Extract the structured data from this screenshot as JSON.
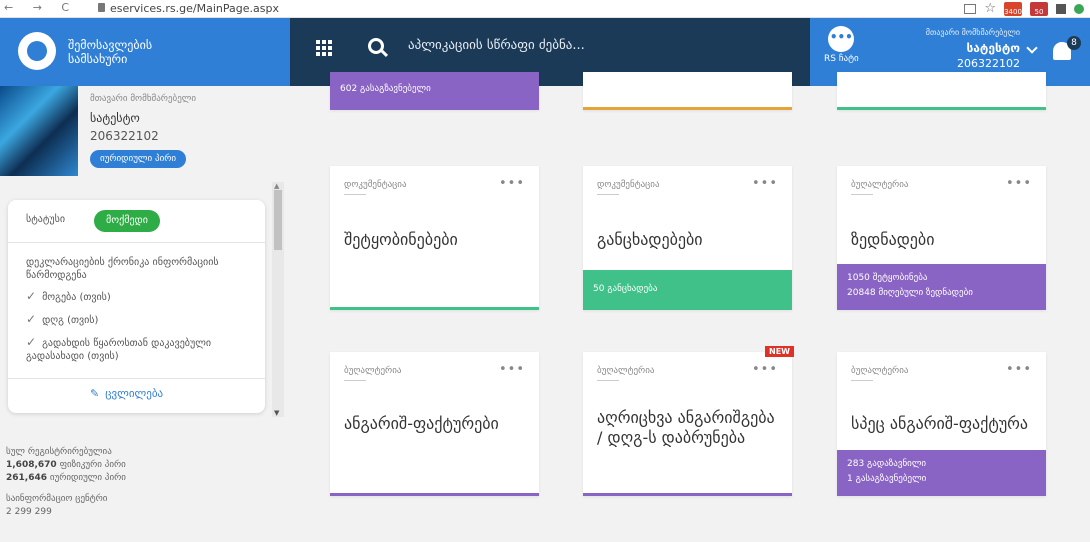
{
  "browser": {
    "url": "eservices.rs.ge/MainPage.aspx",
    "nav_glyphs": "← → C",
    "star": "☆",
    "ext1_count": "3400",
    "ext2_count": "50"
  },
  "header": {
    "brand_line1": "შემოსავლების",
    "brand_line2": "სამსახური",
    "search_placeholder": "აპლიკაციის სწრაფი ძებნა...",
    "chat_label": "RS ჩატი",
    "chat_icon_glyph": "•••",
    "user_role": "მთავარი მომხმარებელი",
    "user_name": "სატესტო",
    "user_id": "206322102",
    "notification_count": "8"
  },
  "sidebar": {
    "profile_role": "მთავარი მომხმარებელი",
    "profile_name": "სატესტო",
    "profile_id": "206322102",
    "profile_type": "იურიდიული პირი",
    "status_label": "სტატუსი",
    "status_value": "მოქმედი",
    "declarations_title": "დეკლარაციების ქრონიკა ინფორმაციის წარმოდგენა",
    "checks": [
      "მოგება (თვის)",
      "დღგ (თვის)",
      "გადახდის წყაროსთან დაკავებული გადასახადი (თვის)"
    ],
    "edit_label": "ცვლილება",
    "stats_label1": "სულ რეგისტრირებულია",
    "stats_val1": "1,608,670",
    "stats_unit1": "ფიზიკური პირი",
    "stats_val2": "261,646",
    "stats_unit2": "იურიდიული პირი",
    "stats_label2": "საინფორმაციო ცენტრი",
    "stats_val3": "2 299 299"
  },
  "tiles_top": {
    "tile1_band": "602 გასაგზავნებელი"
  },
  "tiles": [
    {
      "category": "დოკუმენტაცია",
      "title": "შეტყობინებები",
      "band": ""
    },
    {
      "category": "დოკუმენტაცია",
      "title": "განცხადებები",
      "band": "50 განცხადება"
    },
    {
      "category": "ბუღალტერია",
      "title": "ზედნადები",
      "band_line1": "1050 შეტყობინება",
      "band_line2": "20848 მიღებული ზედნადები"
    },
    {
      "category": "ბუღალტერია",
      "title": "ანგარიშ-ფაქტურები",
      "band": ""
    },
    {
      "category": "ბუღალტერია",
      "title": "აღრიცხვა ანგარიშგება / დღგ-ს დაბრუნება",
      "band": "",
      "badge": "NEW"
    },
    {
      "category": "ბუღალტერია",
      "title": "სპეც ანგარიშ-ფაქტურა",
      "band_line1": "283 გადაზავნილი",
      "band_line2": "1 გასაგზავნებელი"
    }
  ],
  "colors": {
    "header_blue": "#2f7fd6",
    "header_dark": "#1b3a57",
    "purple": "#8a64c4",
    "green": "#3fc189",
    "orange": "#e5a33b",
    "status_green": "#2eac45",
    "new_red": "#e03127"
  }
}
